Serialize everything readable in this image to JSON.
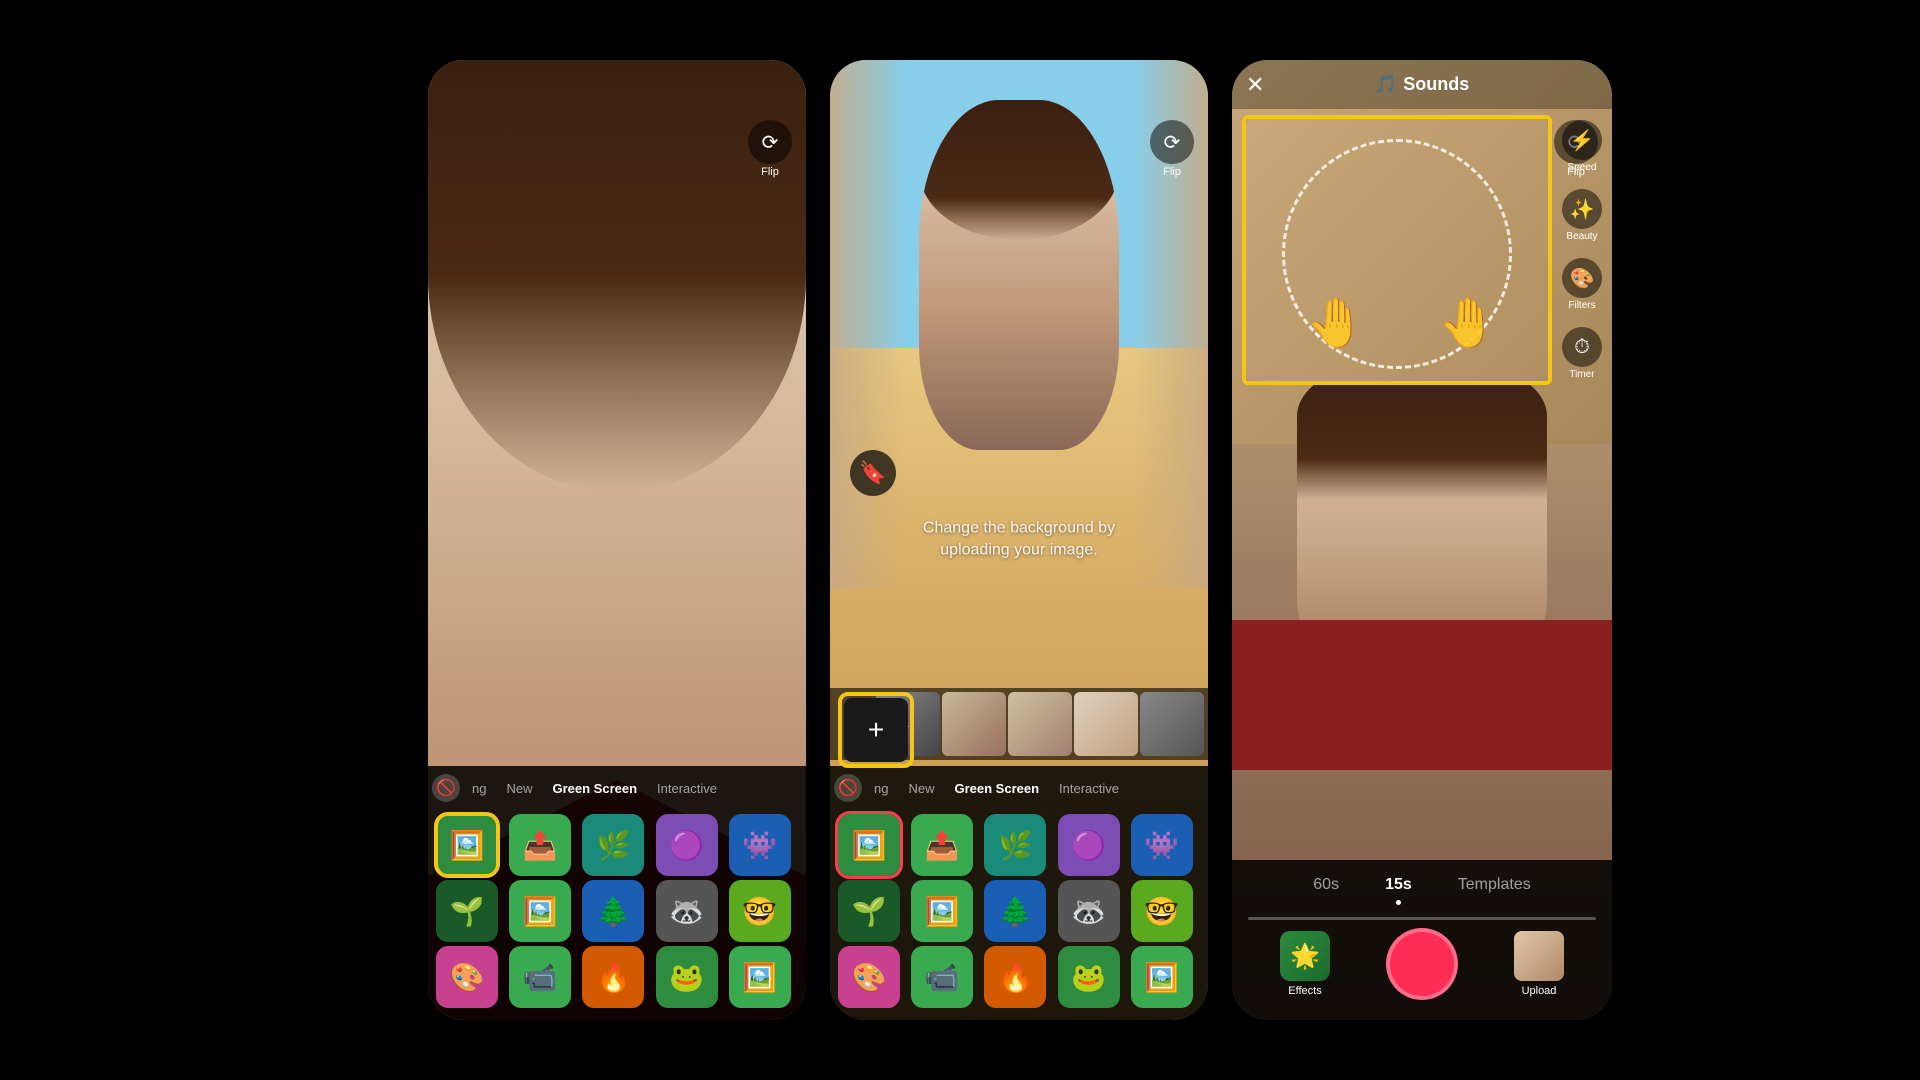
{
  "left_phone": {
    "tabs": [
      "",
      "ng",
      "New",
      "Green Screen",
      "Interactive"
    ],
    "active_tab": "Green Screen",
    "flip_label": "Flip",
    "effects_rows": [
      [
        "green-screen",
        "share-upload",
        "nature-green",
        "purple-blob",
        "character"
      ],
      [
        "plant-white",
        "photo-share",
        "nature2",
        "raccoon",
        "glasses-green"
      ],
      [
        "palette",
        "video-grid",
        "fire-photo",
        "frog",
        "photo-frame"
      ]
    ]
  },
  "middle_phone": {
    "tabs": [
      "",
      "ng",
      "New",
      "Green Screen",
      "Interactive"
    ],
    "active_tab": "Green Screen",
    "upload_text": "Change the background by\nuploading your image.",
    "flip_label": "Flip",
    "carousel_add": "+",
    "effects_rows": [
      [
        "green-screen-sel",
        "share-upload",
        "nature-green",
        "purple-blob",
        "character"
      ],
      [
        "plant-white",
        "photo-share",
        "nature2",
        "raccoon",
        "glasses-green"
      ],
      [
        "palette",
        "video-grid",
        "fire-photo",
        "frog",
        "photo-frame"
      ]
    ]
  },
  "right_phone": {
    "sounds_title": "Sounds",
    "close_icon": "✕",
    "flip_label": "Flip",
    "toolbar": {
      "speed_label": "Speed",
      "beauty_label": "Beauty",
      "filters_label": "Filters",
      "timer_label": "Timer"
    },
    "effects_label": "Effects",
    "upload_label": "Upload",
    "duration_tabs": [
      "60s",
      "15s",
      "Templates"
    ],
    "active_duration": "15s"
  },
  "icons": {
    "flip": "🔄",
    "speed": "⚡",
    "beauty": "✨",
    "filters": "🎨",
    "timer": "⏱",
    "effects": "🌟",
    "sounds": "🎵",
    "close": "✕",
    "bookmark": "🔖",
    "add": "+"
  }
}
